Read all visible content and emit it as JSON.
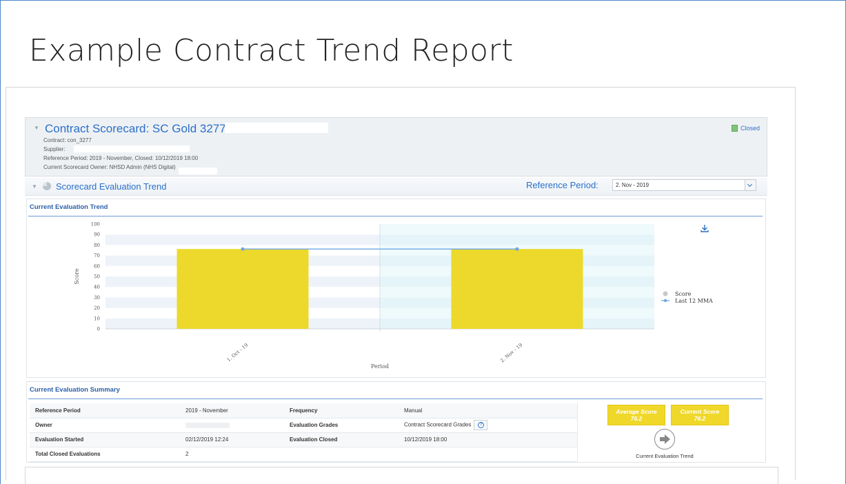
{
  "slide": {
    "title": "Example Contract Trend Report"
  },
  "scorecard": {
    "title": "Contract Scorecard: SC Gold 3277",
    "contract": "Contract: con_3277",
    "supplier": "Supplier:",
    "reference_period": "Reference Period: 2019 - November, Closed: 10/12/2019 18:00",
    "owner": "Current Scorecard Owner: NHSD Admin (NHS Digital)",
    "status": "Closed"
  },
  "trend_section": {
    "title": "Scorecard Evaluation Trend",
    "reference_label": "Reference Period:",
    "reference_value": "2. Nov - 2019"
  },
  "trend_panel": {
    "title": "Current Evaluation Trend"
  },
  "chart_data": {
    "type": "bar",
    "categories": [
      "1. Oct - 19",
      "2. Nov - 19"
    ],
    "series": [
      {
        "name": "Score",
        "type": "bar",
        "values": [
          76.2,
          76.2
        ],
        "color": "#ecd92b"
      },
      {
        "name": "Last 12 MMA",
        "type": "line",
        "values": [
          76.2,
          76.2
        ],
        "color": "#6ea6e6"
      }
    ],
    "xlabel": "Period",
    "ylabel": "Score",
    "ylim": [
      0,
      100
    ],
    "yticks": [
      0,
      10,
      20,
      30,
      40,
      50,
      60,
      70,
      80,
      90,
      100
    ],
    "legend_position": "right",
    "legend_swatch_color": "#c8c8c8"
  },
  "summary": {
    "title": "Current Evaluation Summary",
    "rows": [
      {
        "l1": "Reference Period",
        "v1": "2019 - November",
        "l2": "Frequency",
        "v2": "Manual"
      },
      {
        "l1": "Owner",
        "v1": "",
        "l2": "Evaluation Grades",
        "v2": "Contract Scorecard Grades"
      },
      {
        "l1": "Evaluation Started",
        "v1": "02/12/2019 12:24",
        "l2": "Evaluation Closed",
        "v2": "10/12/2019 18:00"
      },
      {
        "l1": "Total Closed Evaluations",
        "v1": "2",
        "l2": "",
        "v2": ""
      }
    ],
    "average_label": "Average Score",
    "average_value": "76.2",
    "current_label": "Current Score",
    "current_value": "76.2",
    "trend_caption": "Current Evaluation Trend"
  }
}
